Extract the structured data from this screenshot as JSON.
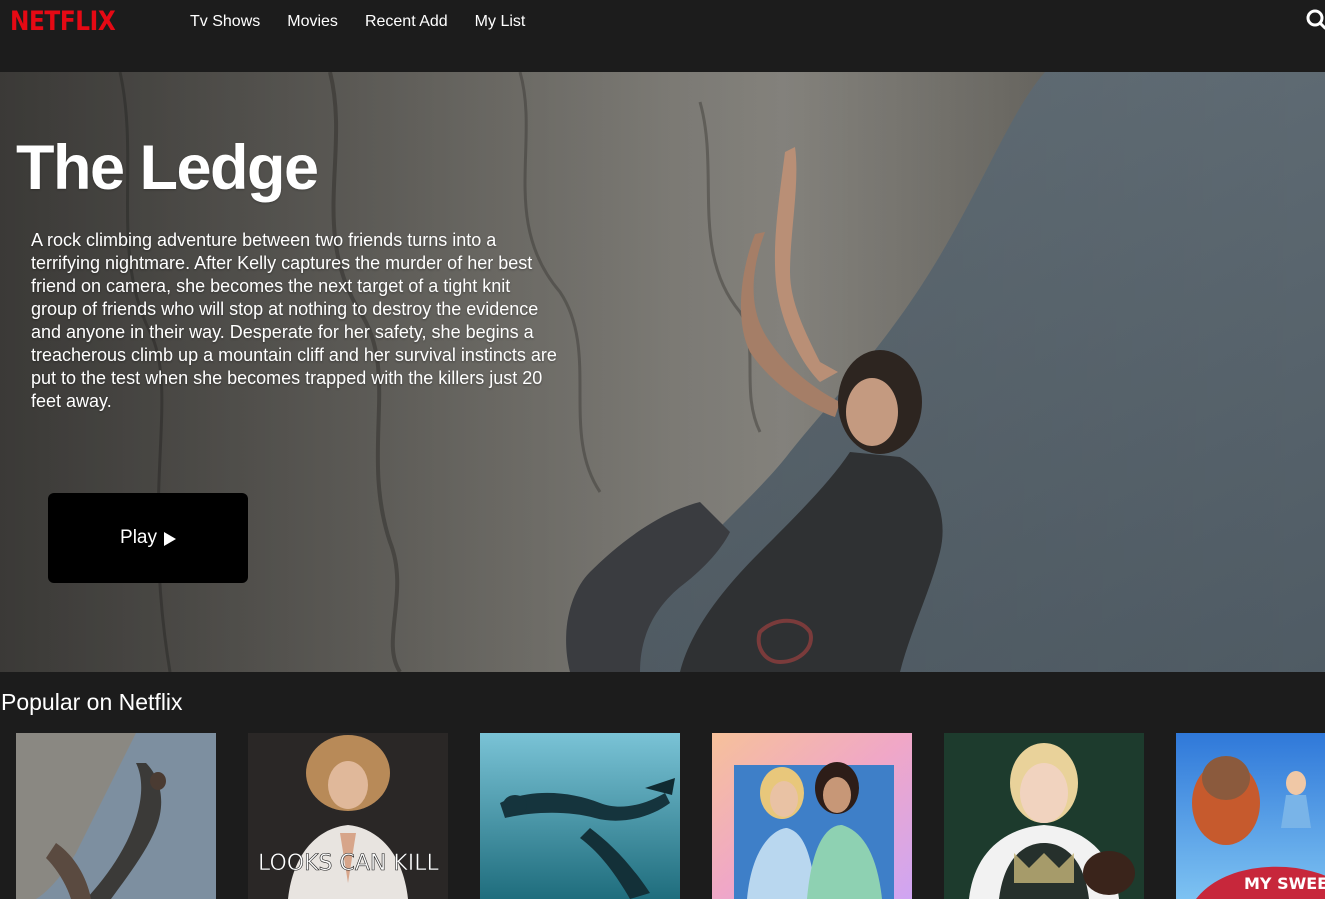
{
  "brand": {
    "logo_text": "NETFLIX",
    "color": "#e50914"
  },
  "nav": {
    "items": [
      {
        "label": "Tv Shows"
      },
      {
        "label": "Movies"
      },
      {
        "label": "Recent Add"
      },
      {
        "label": "My List"
      }
    ],
    "search_icon": "search-icon"
  },
  "hero": {
    "title": "The Ledge",
    "description": "A rock climbing adventure between two friends turns into a terrifying nightmare. After Kelly captures the murder of her best friend on camera, she becomes the next target of a tight knit group of friends who will stop at nothing to destroy the evidence and anyone in their way. Desperate for her safety, she begins a treacherous climb up a mountain cliff and her survival instincts are put to the test when she becomes trapped with the killers just 20 feet away.",
    "play_label": "Play",
    "play_icon": "play-icon"
  },
  "popular": {
    "title": "Popular on Netflix",
    "posters": [
      {
        "name": "rock-climbing-poster"
      },
      {
        "name": "looks-can-kill-poster",
        "artwork_text": "LOOKS CAN KILL"
      },
      {
        "name": "underwater-diver-poster"
      },
      {
        "name": "school-girls-poster"
      },
      {
        "name": "school-portrait-poster"
      },
      {
        "name": "my-sweet-monster-poster",
        "artwork_text": "MY SWEET"
      }
    ]
  }
}
